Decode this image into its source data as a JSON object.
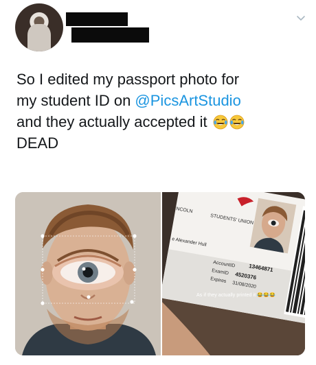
{
  "tweet": {
    "line1": "So I edited my passport photo for",
    "line2_prefix": "my student ID on ",
    "line2_mention": "@PicsArtStudio",
    "line3": "and they actually accepted it",
    "line4": "DEAD"
  },
  "card": {
    "university": "NCOLN",
    "union": "STUDENTS' UNION",
    "name": "e Alexander Hull",
    "account_label": "AccountID",
    "account_value": "13464871",
    "exam_label": "ExamID",
    "exam_value": "4520376",
    "expires_label": "Expires",
    "expires_value": "31/08/2020",
    "overlay_caption": "As if they actually printed it"
  },
  "icons": {
    "caret": "chevron-down-icon",
    "emoji": "face-with-tears-of-joy-icon"
  },
  "colors": {
    "mention": "#1b95e0",
    "text": "#14171a",
    "emoji_face": "#f7c83a"
  }
}
